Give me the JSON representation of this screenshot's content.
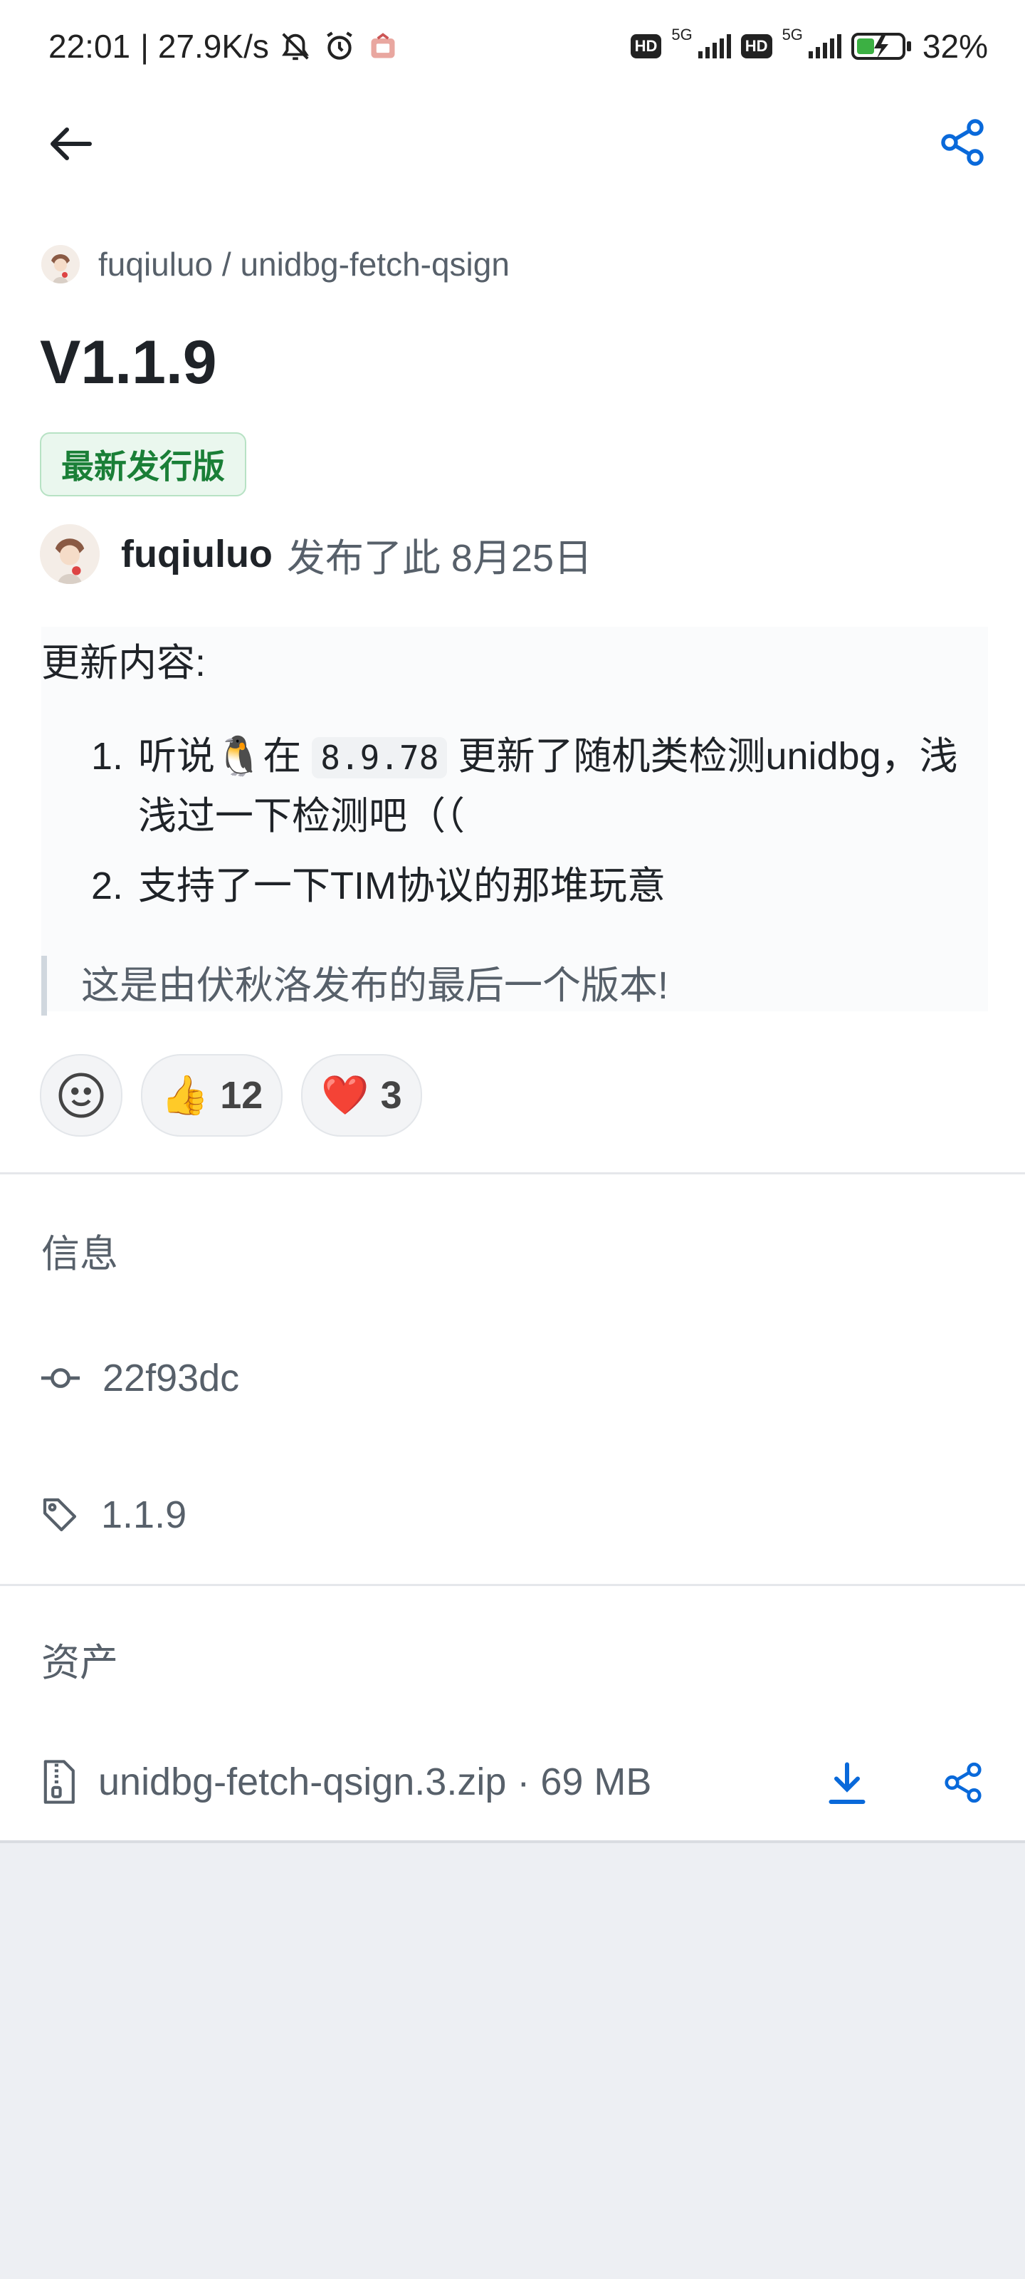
{
  "status_bar": {
    "time": "22:01",
    "speed": "| 27.9K/s",
    "battery": "32%",
    "hd": "HD",
    "network": "5G"
  },
  "header": {
    "repo": "fuqiuluo / unidbg-fetch-qsign"
  },
  "release": {
    "title": "V1.1.9",
    "badge": "最新发行版",
    "author": "fuqiuluo",
    "published_text": "发布了此 8月25日"
  },
  "notes": {
    "heading": "更新内容:",
    "items": [
      {
        "num": "1.",
        "text_a": "听说🐧在",
        "code": "8.9.78",
        "text_b": "更新了随机类检测unidbg，浅",
        "text_c": "浅过一下检测吧（（"
      },
      {
        "num": "2.",
        "text": "支持了一下TIM协议的那堆玩意"
      }
    ],
    "quote": "这是由伏秋洛发布的最后一个版本!"
  },
  "reactions": [
    {
      "emoji": "👍",
      "count": "12"
    },
    {
      "emoji": "❤️",
      "count": "3"
    }
  ],
  "info": {
    "heading": "信息",
    "commit": "22f93dc",
    "tag": "1.1.9"
  },
  "assets": {
    "heading": "资产",
    "file": "unidbg-fetch-qsign.3.zip · 69 MB"
  },
  "colors": {
    "accent": "#0969da",
    "badge_green": "#1a7f37",
    "muted": "#57606a"
  }
}
